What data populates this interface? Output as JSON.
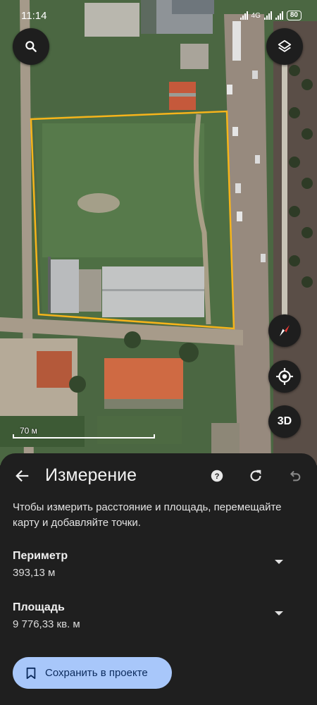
{
  "status_bar": {
    "time": "11:14",
    "network": "4G",
    "battery": "80"
  },
  "map": {
    "scale_label": "70 м",
    "btn_3d": "3D",
    "icons": {
      "search": "search-icon",
      "layers": "layers-icon",
      "compass": "compass-icon",
      "locate": "my-location-icon"
    },
    "colors": {
      "measure_outline": "#f6b41b"
    }
  },
  "sheet": {
    "title": "Измерение",
    "hint": "Чтобы измерить расстояние и площадь, перемещайте карту и добавляйте точки.",
    "perimeter": {
      "label": "Периметр",
      "value": "393,13 м"
    },
    "area": {
      "label": "Площадь",
      "value": "9 776,33 кв. м"
    },
    "save_label": "Сохранить в проекте",
    "colors": {
      "save_button_bg": "#a8c7fa",
      "sheet_bg": "#1f1f1f"
    }
  }
}
